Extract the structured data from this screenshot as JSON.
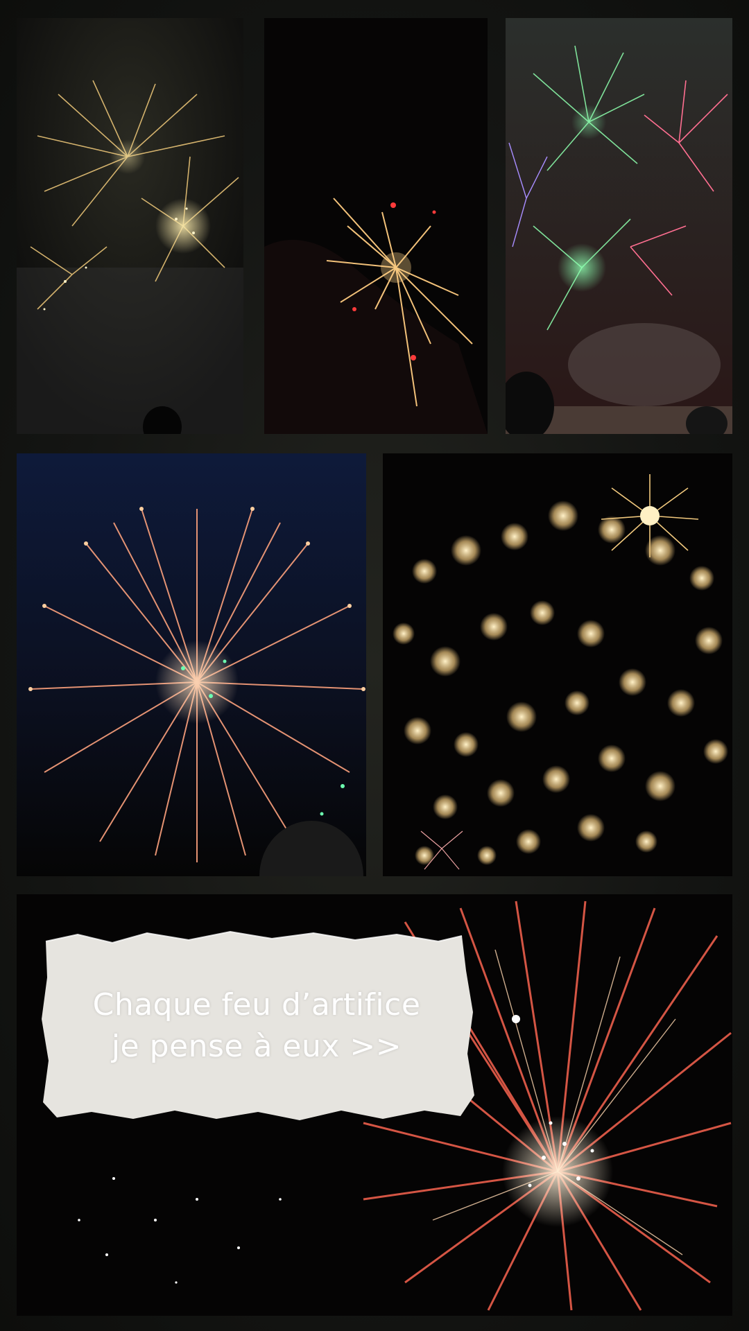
{
  "caption": {
    "line1": "Chaque feu d’artifice",
    "line2": "je pense à eux >>"
  },
  "colors": {
    "background": "#141513",
    "caption_text": "#ffffff",
    "paper": "#e6e4df"
  }
}
